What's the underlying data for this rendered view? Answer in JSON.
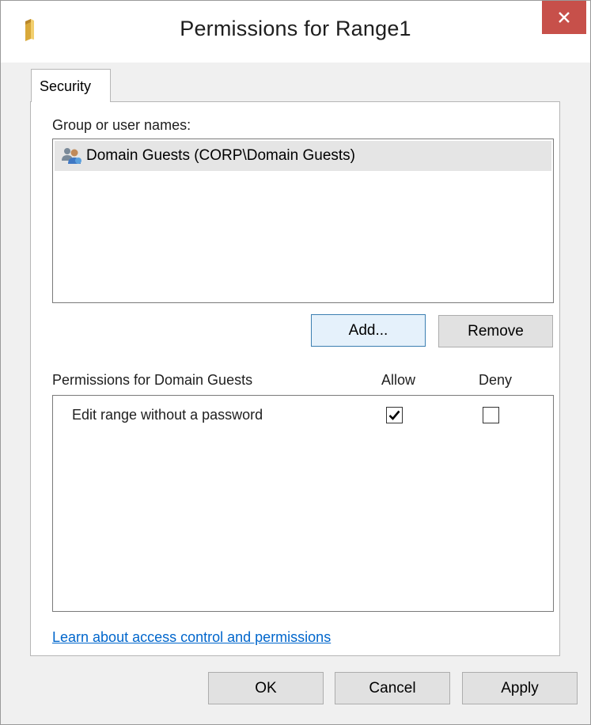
{
  "window": {
    "title": "Permissions for Range1",
    "close_glyph": "✕"
  },
  "tabs": [
    {
      "label": "Security",
      "selected": true
    }
  ],
  "group_list": {
    "label": "Group or user names:",
    "items": [
      {
        "name": "Domain Guests (CORP\\Domain Guests)",
        "icon": "users-group-icon",
        "selected": true
      }
    ]
  },
  "group_buttons": {
    "add_label": "Add...",
    "remove_label": "Remove"
  },
  "permissions": {
    "header_label": "Permissions for Domain Guests",
    "allow_header": "Allow",
    "deny_header": "Deny",
    "rows": [
      {
        "name": "Edit range without a password",
        "allow": true,
        "deny": false
      }
    ]
  },
  "learn_link": "Learn about access control and permissions",
  "dialog_buttons": {
    "ok_label": "OK",
    "cancel_label": "Cancel",
    "apply_label": "Apply"
  },
  "colors": {
    "close_button": "#c7504a",
    "link": "#0066cc",
    "default_button_border": "#3c7fb1"
  }
}
